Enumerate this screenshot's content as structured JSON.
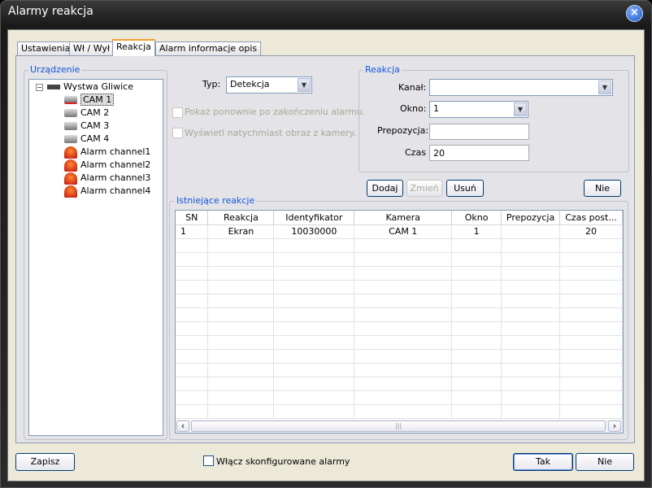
{
  "window": {
    "title": "Alarmy reakcja",
    "close_icon": "close-icon"
  },
  "tabs": [
    {
      "label": "Ustawienia"
    },
    {
      "label": "Wł / Wył"
    },
    {
      "label": "Reakcja",
      "active": true
    },
    {
      "label": "Alarm informacje opis"
    }
  ],
  "device_group": {
    "title": "Urządzenie",
    "root": {
      "label": "Wystwa Gliwice",
      "icon": "dvr-icon"
    },
    "items": [
      {
        "label": "CAM 1",
        "icon": "camera-checked-icon",
        "selected": true
      },
      {
        "label": "CAM 2",
        "icon": "camera-icon"
      },
      {
        "label": "CAM 3",
        "icon": "camera-icon"
      },
      {
        "label": "CAM 4",
        "icon": "camera-icon"
      },
      {
        "label": "Alarm channel1",
        "icon": "alarm-light-icon"
      },
      {
        "label": "Alarm channel2",
        "icon": "alarm-light-icon"
      },
      {
        "label": "Alarm channel3",
        "icon": "alarm-light-icon"
      },
      {
        "label": "Alarm channel4",
        "icon": "alarm-light-icon"
      }
    ]
  },
  "type": {
    "label": "Typ:",
    "value": "Detekcja"
  },
  "options": {
    "show_again": "Pokaż ponownie po zakończeniu alarmu.",
    "show_image": "Wyświetl natychmiast obraz  z kamery."
  },
  "reaction": {
    "title": "Reakcja",
    "channel_label": "Kanał:",
    "channel_value": "",
    "window_label": "Okno:",
    "window_value": "1",
    "preset_label": "Prepozycja:",
    "preset_value": "",
    "time_label": "Czas",
    "time_value": "20"
  },
  "actions": {
    "add": "Dodaj",
    "change": "Zmień",
    "delete": "Usuń",
    "no": "Nie"
  },
  "existing": {
    "title": "Istniejące reakcje",
    "columns": [
      "SN",
      "Reakcja",
      "Identyfikator",
      "Kamera",
      "Okno",
      "Prepozycja",
      "Czas post..."
    ],
    "rows": [
      [
        "1",
        "Ekran",
        "10030000",
        "CAM 1",
        "1",
        "",
        "20"
      ]
    ]
  },
  "footer": {
    "save": "Zapisz",
    "enable_label": "Włącz skonfigurowane alarmy",
    "enable_checked": false,
    "ok": "Tak",
    "cancel": "Nie"
  }
}
